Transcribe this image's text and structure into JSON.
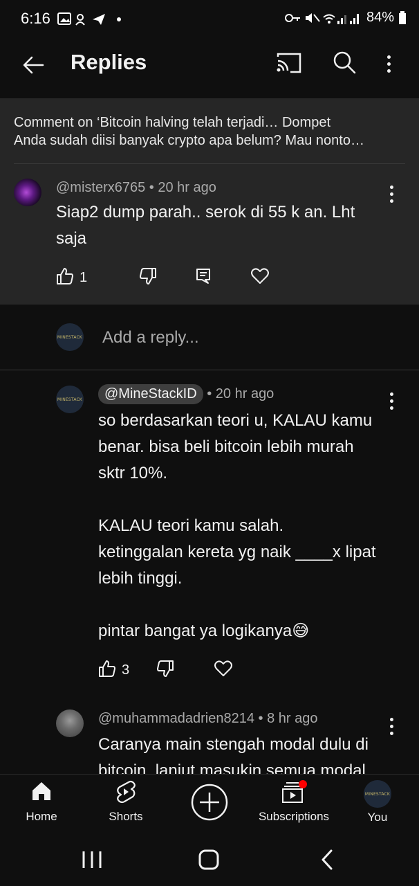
{
  "status": {
    "time": "6:16",
    "battery": "84%"
  },
  "header": {
    "title": "Replies"
  },
  "origin": {
    "context_line1": "Comment on ‘Bitcoin halving telah terjadi… Dompet",
    "context_line2": "Anda sudah diisi banyak crypto apa belum? Mau nonto…",
    "author": "@misterx6765",
    "time": "20 hr ago",
    "text_line1": "Siap2 dump parah.. serok di 55 k an.  Lht",
    "text_line2": "saja",
    "likes": "1"
  },
  "reply_input": {
    "placeholder": "Add a reply...",
    "avatar_text": "MINESTACK"
  },
  "replies": [
    {
      "author": "@MineStackID",
      "time": "20 hr ago",
      "avatar_text": "MINESTACK",
      "lines": [
        "so berdasarkan teori u, KALAU kamu",
        "benar. bisa beli bitcoin lebih murah",
        "sktr 10%.",
        "",
        "KALAU teori kamu salah.",
        "ketinggalan kereta yg naik ____x lipat",
        "lebih tinggi.",
        "",
        "pintar bangat ya logikanya😅"
      ],
      "likes": "3"
    },
    {
      "author": "@muhammadadrien8214",
      "time": "8 hr ago",
      "lines": [
        "Caranya main stengah modal dulu di",
        "bitcoin. lanjut masukin semua modal"
      ]
    }
  ],
  "nav": {
    "home": "Home",
    "shorts": "Shorts",
    "subscriptions": "Subscriptions",
    "you": "You",
    "you_avatar_text": "MINESTACK"
  },
  "colors": {
    "bg": "#0f0f0f",
    "card": "#262626",
    "notify": "#ff0000"
  }
}
